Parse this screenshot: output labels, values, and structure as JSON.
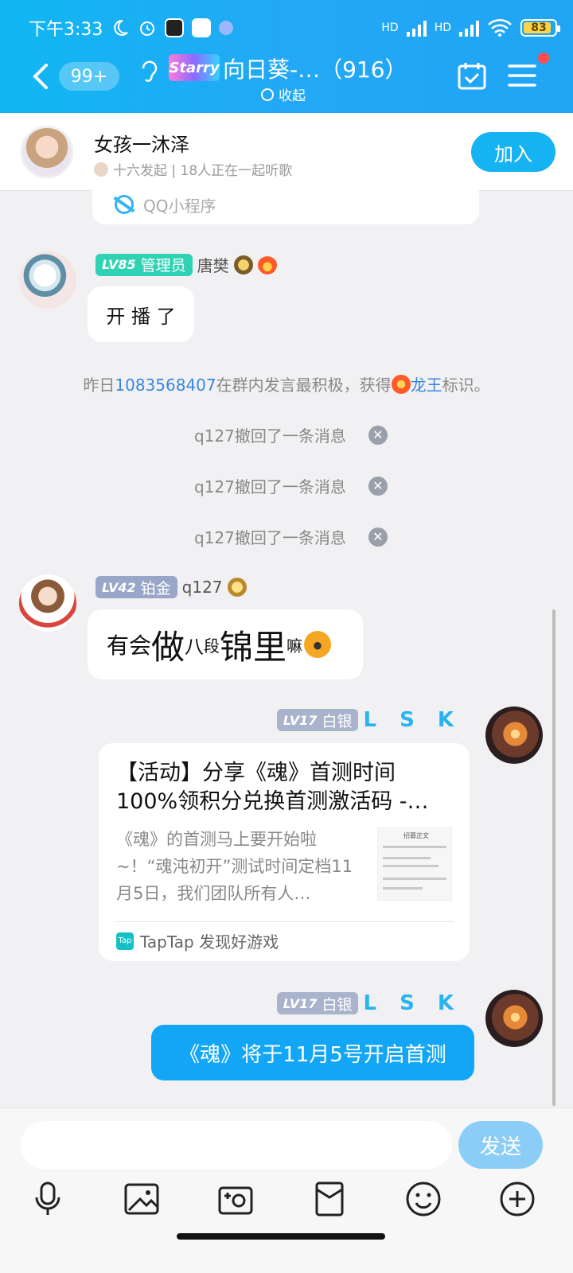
{
  "status": {
    "time": "下午3:33",
    "battery": "83",
    "hd1": "HD",
    "hd2": "HD"
  },
  "header": {
    "unread": "99+",
    "group_logo_text": "Starry",
    "group_title": "向日葵-…（916）",
    "collapse_label": "收起"
  },
  "listen_together": {
    "name": "女孩一沐泽",
    "subtitle": "十六发起 | 18人正在一起听歌",
    "join_label": "加入"
  },
  "mini_program": {
    "label": "QQ小程序"
  },
  "messages": [
    {
      "level": "LV85",
      "title": "管理员",
      "sender": "唐樊",
      "text": "开 播 了"
    },
    {
      "level": "LV42",
      "title": "铂金",
      "sender": "q127",
      "parts": [
        "有会",
        "做",
        "八",
        "段",
        "锦里",
        "嘛"
      ]
    },
    {
      "level": "LV17",
      "title": "白银",
      "sender": "L S K"
    },
    {
      "level": "LV17",
      "title": "白银",
      "sender": "L S K",
      "text": "《魂》将于11月5号开启首测"
    }
  ],
  "system": {
    "notice_pre": "昨日",
    "notice_user": "1083568407",
    "notice_mid": "在群内发言最积极，获得",
    "notice_tag": "龙王",
    "notice_post": "标识。",
    "recalls": [
      "q127撤回了一条消息",
      "q127撤回了一条消息",
      "q127撤回了一条消息"
    ]
  },
  "share_card": {
    "title": "【活动】分享《魂》首测时间100%领积分兑换首测激活码 -…",
    "description": "《魂》的首测马上要开始啦~！“魂沌初开”测试时间定档11月5日，我们团队所有人…",
    "thumb_text": "招募正文",
    "source_icon": "Tap",
    "source": "TapTap 发现好游戏"
  },
  "input": {
    "placeholder": "",
    "send_label": "发送"
  },
  "colors": {
    "accent": "#16b3f2",
    "admin_badge": "#2fd3b4",
    "my_bubble": "#13a6f6"
  },
  "icons": [
    "back-icon",
    "ear-icon",
    "calendar-check-icon",
    "menu-icon",
    "mic-icon",
    "image-icon",
    "camera-icon",
    "red-packet-icon",
    "emoji-icon",
    "plus-icon"
  ]
}
